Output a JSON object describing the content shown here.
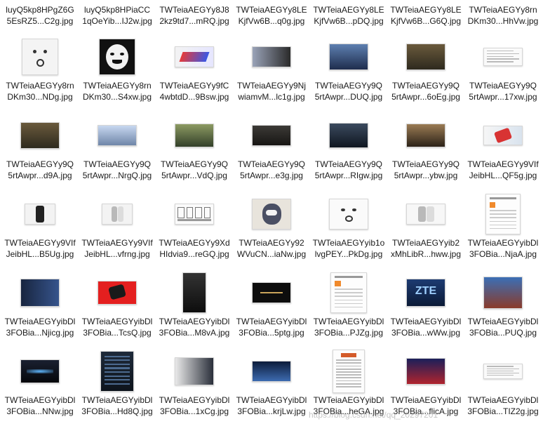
{
  "files": [
    {
      "line1": "luyQ5kp8HPgZ6G",
      "line2": "5EsRZ5...C2g.jpg",
      "thumb": "none"
    },
    {
      "line1": "luyQ5kp8HPiaCC",
      "line2": "1qOeYib...IJ2w.jpg",
      "thumb": "none"
    },
    {
      "line1": "TWTeiaAEGYy8J8",
      "line2": "2kz9td7...mRQ.jpg",
      "thumb": "none"
    },
    {
      "line1": "TWTeiaAEGYy8LE",
      "line2": "KjfVw6B...q0g.jpg",
      "thumb": "none"
    },
    {
      "line1": "TWTeiaAEGYy8LE",
      "line2": "KjfVw6B...pDQ.jpg",
      "thumb": "none"
    },
    {
      "line1": "TWTeiaAEGYy8LE",
      "line2": "KjfVw6B...G6Q.jpg",
      "thumb": "none"
    },
    {
      "line1": "TWTeiaAEGYy8rn",
      "line2": "DKm30...HhVw.jpg",
      "thumb": "none"
    },
    {
      "line1": "TWTeiaAEGYy8rn",
      "line2": "DKm30...NDg.jpg",
      "thumb": "meme-face-1"
    },
    {
      "line1": "TWTeiaAEGYy8rn",
      "line2": "DKm30...S4xw.jpg",
      "thumb": "meme-face-2"
    },
    {
      "line1": "TWTeiaAEGYy9fC",
      "line2": "4wbtdD...9Bsw.jpg",
      "thumb": "logo-banner"
    },
    {
      "line1": "TWTeiaAEGYy9Nj",
      "line2": "wiamvM...lc1g.jpg",
      "thumb": "phone-banner"
    },
    {
      "line1": "TWTeiaAEGYy9Q",
      "line2": "5rtAwpr...DUQ.jpg",
      "thumb": "person-photo"
    },
    {
      "line1": "TWTeiaAEGYy9Q",
      "line2": "5rtAwpr...6oEg.jpg",
      "thumb": "game-scene"
    },
    {
      "line1": "TWTeiaAEGYy9Q",
      "line2": "5rtAwpr...17xw.jpg",
      "thumb": "text-page"
    },
    {
      "line1": "TWTeiaAEGYy9Q",
      "line2": "5rtAwpr...d9A.jpg",
      "thumb": "game-scene"
    },
    {
      "line1": "TWTeiaAEGYy9Q",
      "line2": "5rtAwpr...NrgQ.jpg",
      "thumb": "room-photo"
    },
    {
      "line1": "TWTeiaAEGYy9Q",
      "line2": "5rtAwpr...VdQ.jpg",
      "thumb": "game-scene-2"
    },
    {
      "line1": "TWTeiaAEGYy9Q",
      "line2": "5rtAwpr...e3g.jpg",
      "thumb": "dark-photo"
    },
    {
      "line1": "TWTeiaAEGYy9Q",
      "line2": "5rtAwpr...RIgw.jpg",
      "thumb": "night-street"
    },
    {
      "line1": "TWTeiaAEGYy9Q",
      "line2": "5rtAwpr...ybw.jpg",
      "thumb": "game-scene-3"
    },
    {
      "line1": "TWTeiaAEGYy9VIf",
      "line2": "JeibHL...QF5g.jpg",
      "thumb": "phone-product"
    },
    {
      "line1": "TWTeiaAEGYy9VIf",
      "line2": "JeibHL...B5Ug.jpg",
      "thumb": "hand-phone"
    },
    {
      "line1": "TWTeiaAEGYy9VIf",
      "line2": "JeibHL...vfrng.jpg",
      "thumb": "phone-silver"
    },
    {
      "line1": "TWTeiaAEGYy9Xd",
      "line2": "HIdvia9...reGQ.jpg",
      "thumb": "comic-strip"
    },
    {
      "line1": "TWTeiaAEGYy92",
      "line2": "WVuCN...iaNw.jpg",
      "thumb": "cartoon"
    },
    {
      "line1": "TWTeiaAEGYyib1o",
      "line2": "lvgPEY...PkDg.jpg",
      "thumb": "meme-face-3"
    },
    {
      "line1": "TWTeiaAEGYyib2",
      "line2": "xMhLibR...hww.jpg",
      "thumb": "phone-white"
    },
    {
      "line1": "TWTeiaAEGYyibDl",
      "line2": "3FOBia...NjaA.jpg",
      "thumb": "form-page"
    },
    {
      "line1": "TWTeiaAEGYyibDl",
      "line2": "3FOBia...Njicg.jpg",
      "thumb": "blue-dark"
    },
    {
      "line1": "TWTeiaAEGYyibDl",
      "line2": "3FOBia...TcsQ.jpg",
      "thumb": "red-product"
    },
    {
      "line1": "TWTeiaAEGYyibDl",
      "line2": "3FOBia...M8vA.jpg",
      "thumb": "phone-black"
    },
    {
      "line1": "TWTeiaAEGYyibDl",
      "line2": "3FOBia...5ptg.jpg",
      "thumb": "black-logo"
    },
    {
      "line1": "TWTeiaAEGYyibDl",
      "line2": "3FOBia...PJZg.jpg",
      "thumb": "form-page-2"
    },
    {
      "line1": "TWTeiaAEGYyibDl",
      "line2": "3FOBia...wWw.jpg",
      "thumb": "zte-logo"
    },
    {
      "line1": "TWTeiaAEGYyibDl",
      "line2": "3FOBia...PUQ.jpg",
      "thumb": "game-screens"
    },
    {
      "line1": "TWTeiaAEGYyibDl",
      "line2": "3FOBia...NNw.jpg",
      "thumb": "widescreen"
    },
    {
      "line1": "TWTeiaAEGYyibDl",
      "line2": "3FOBia...Hd8Q.jpg",
      "thumb": "app-dark"
    },
    {
      "line1": "TWTeiaAEGYyibDl",
      "line2": "3FOBia...1xCg.jpg",
      "thumb": "phone-game"
    },
    {
      "line1": "TWTeiaAEGYyibDl",
      "line2": "3FOBia...krjLw.jpg",
      "thumb": "stage-event"
    },
    {
      "line1": "TWTeiaAEGYyibDl",
      "line2": "3FOBia...heGA.jpg",
      "thumb": "document-list"
    },
    {
      "line1": "TWTeiaAEGYyibDl",
      "line2": "3FOBia...flicA.jpg",
      "thumb": "esports-banner"
    },
    {
      "line1": "TWTeiaAEGYyibDl",
      "line2": "3FOBia...TIZ2g.jpg",
      "thumb": "small-text"
    }
  ],
  "thumb_text": {
    "zte": "ZTE"
  },
  "watermark": "https://blog.csdn.net/qq_20297201"
}
